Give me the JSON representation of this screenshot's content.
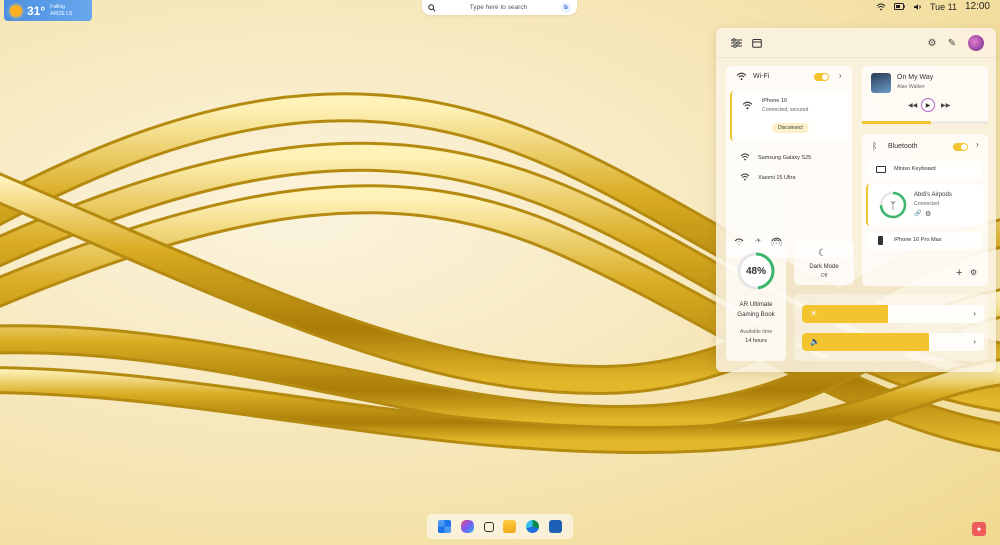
{
  "weather": {
    "temp": "31°",
    "condition": "Falling",
    "sub": "ARIZE LS",
    "icon": "sun-icon"
  },
  "search": {
    "placeholder": "Type here to search"
  },
  "tray": {
    "date": "Tue 11",
    "time": "12:00"
  },
  "panel": {
    "wifi": {
      "title": "Wi-Fi",
      "enabled": true,
      "connected": {
        "name": "iPhone 16",
        "status": "Connected, secured",
        "button": "Disconnect"
      },
      "networks": [
        "Samsung Galaxy S25",
        "Xiaomi 15 Ultra"
      ]
    },
    "media": {
      "title": "On My Way",
      "artist": "Alan Walker",
      "progress": 0.55
    },
    "bluetooth": {
      "title": "Bluetooth",
      "enabled": true,
      "devices": [
        {
          "name": "Miniso Keyboard"
        },
        {
          "name": "Abdi's Airpods",
          "status": "Connected"
        },
        {
          "name": "iPhone 16 Pro Max"
        }
      ]
    },
    "battery": {
      "percent_label": "48%",
      "percent": 48,
      "device_line1": "AR Ultimate",
      "device_line2": "Gaming Book",
      "available_label": "Available time",
      "available_value": "14 hours"
    },
    "dark_mode": {
      "title": "Dark Mode",
      "state": "Off"
    },
    "brightness": {
      "level": 0.47
    },
    "volume": {
      "level": 0.7
    }
  },
  "colors": {
    "accent": "#f4c430",
    "battery_ring": "#3bb56c",
    "airpods_ring": "#3bb56c"
  }
}
